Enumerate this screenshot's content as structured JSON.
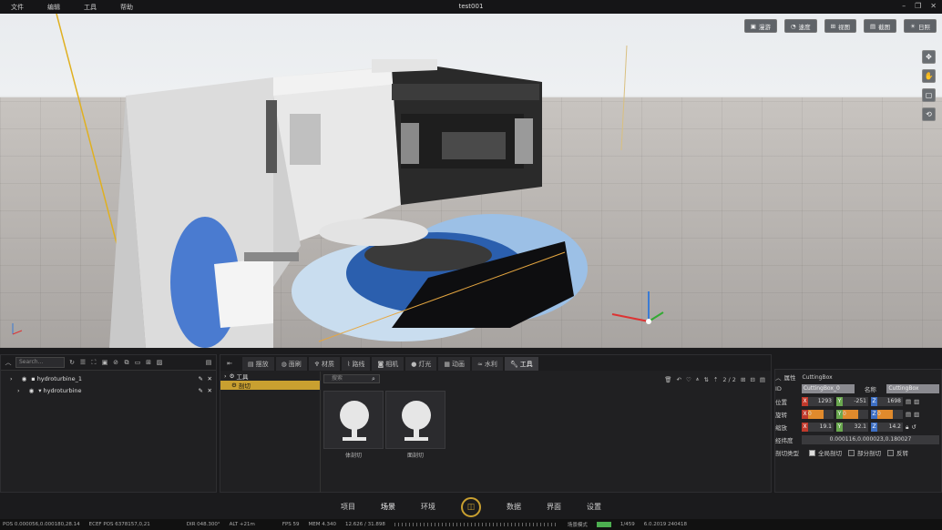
{
  "menu": {
    "items": [
      "文件",
      "编辑",
      "工具",
      "帮助"
    ],
    "title": "test001"
  },
  "viewport": {
    "buttons": [
      "漫游",
      "速度",
      "视图",
      "截图",
      "日照"
    ]
  },
  "outliner": {
    "search_placeholder": "Search...",
    "items": [
      {
        "label": "hydroturbine_1"
      },
      {
        "label": "hydroturbine"
      }
    ]
  },
  "tabs": [
    "摆放",
    "面刷",
    "材质",
    "路线",
    "相机",
    "灯光",
    "动画",
    "水利",
    "工具"
  ],
  "content": {
    "pages": "2 / 2",
    "search_placeholder": "搜索",
    "tree": [
      {
        "label": "工具"
      },
      {
        "label": "剖切"
      }
    ],
    "cards": [
      {
        "label": "体剖切"
      },
      {
        "label": "面剖切"
      }
    ]
  },
  "properties": {
    "header_label": "属性",
    "header_value": "CuttingBox",
    "id_label": "ID",
    "id_value": "CuttingBox_0",
    "name_label": "名称",
    "name_value": "CuttingBox",
    "position_label": "位置",
    "position": [
      "1293",
      "-251",
      "1698"
    ],
    "rotation_label": "旋转",
    "rotation": [
      "0",
      "0",
      "0"
    ],
    "scale_label": "缩放",
    "scale": [
      "19.1",
      "32.1",
      "14.2"
    ],
    "path_label": "经纬度",
    "path_value": "0.000116,0.000023,0.180027",
    "cut_type_label": "剖切类型",
    "options": [
      "全局剖切",
      "部分剖切",
      "反转"
    ]
  },
  "bottom_nav": [
    "项目",
    "场景",
    "环境",
    "数据",
    "界面",
    "设置"
  ],
  "status": {
    "pos_label": "POS",
    "pos_value": "0.000056,0.000180,28.14",
    "ecef_label": "ECEF POS",
    "ecef_value": "6378157,0,21",
    "dir_label": "DIR",
    "dir_value": "048.300°",
    "alt_label": "ALT",
    "alt_value": "+21m",
    "fps_label": "FPS",
    "fps_value": "59",
    "mem_label": "MEM",
    "mem_value": "4.340",
    "mem_detail": "12.626 / 31.898",
    "mode_label": "场景模式",
    "count": "1/459",
    "version": "6.0.2019 240418"
  }
}
